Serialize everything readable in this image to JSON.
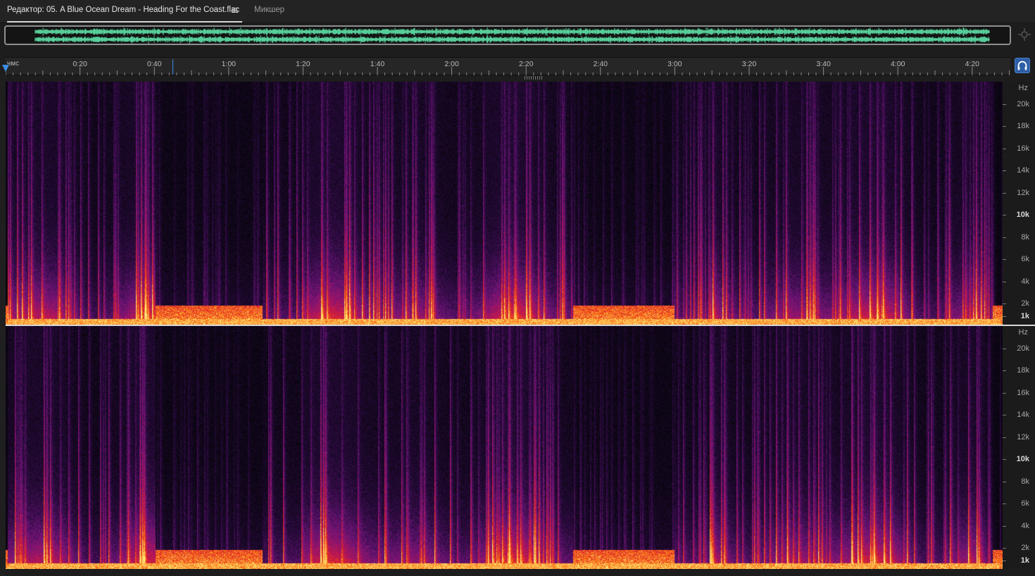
{
  "tabs": {
    "editor": "Редактор: 05. A Blue Ocean Dream - Heading For the Coast.flac",
    "mixer": "Микшер"
  },
  "ruler": {
    "unit": "чмс",
    "labels": [
      "0:20",
      "0:40",
      "1:00",
      "1:20",
      "1:40",
      "2:00",
      "2:20",
      "2:40",
      "3:00",
      "3:20",
      "3:40",
      "4:00",
      "4:20"
    ]
  },
  "frequency_scale": {
    "unit": "Hz",
    "labels": [
      "20k",
      "18k",
      "16k",
      "14k",
      "12k",
      "10k",
      "8k",
      "6k",
      "4k",
      "2k",
      "1k"
    ]
  },
  "colors": {
    "waveform": "#5fe0a8",
    "playhead": "#3b8ee6",
    "background": "#1d1d1d"
  },
  "icons": {
    "zoom_navigator": "zoom-navigator-icon",
    "monitor": "headphones-icon",
    "tab_menu": "hamburger-icon"
  }
}
